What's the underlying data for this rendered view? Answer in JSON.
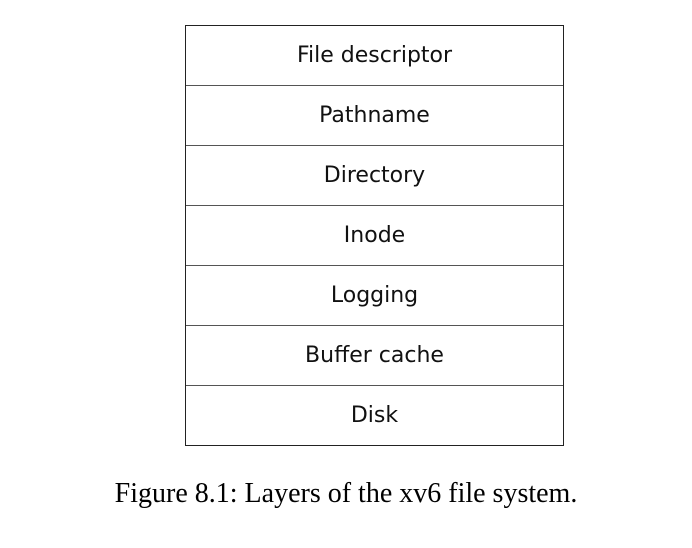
{
  "diagram": {
    "layers": [
      "File descriptor",
      "Pathname",
      "Directory",
      "Inode",
      "Logging",
      "Buffer cache",
      "Disk"
    ],
    "caption": "Figure 8.1: Layers of the xv6 file system."
  }
}
